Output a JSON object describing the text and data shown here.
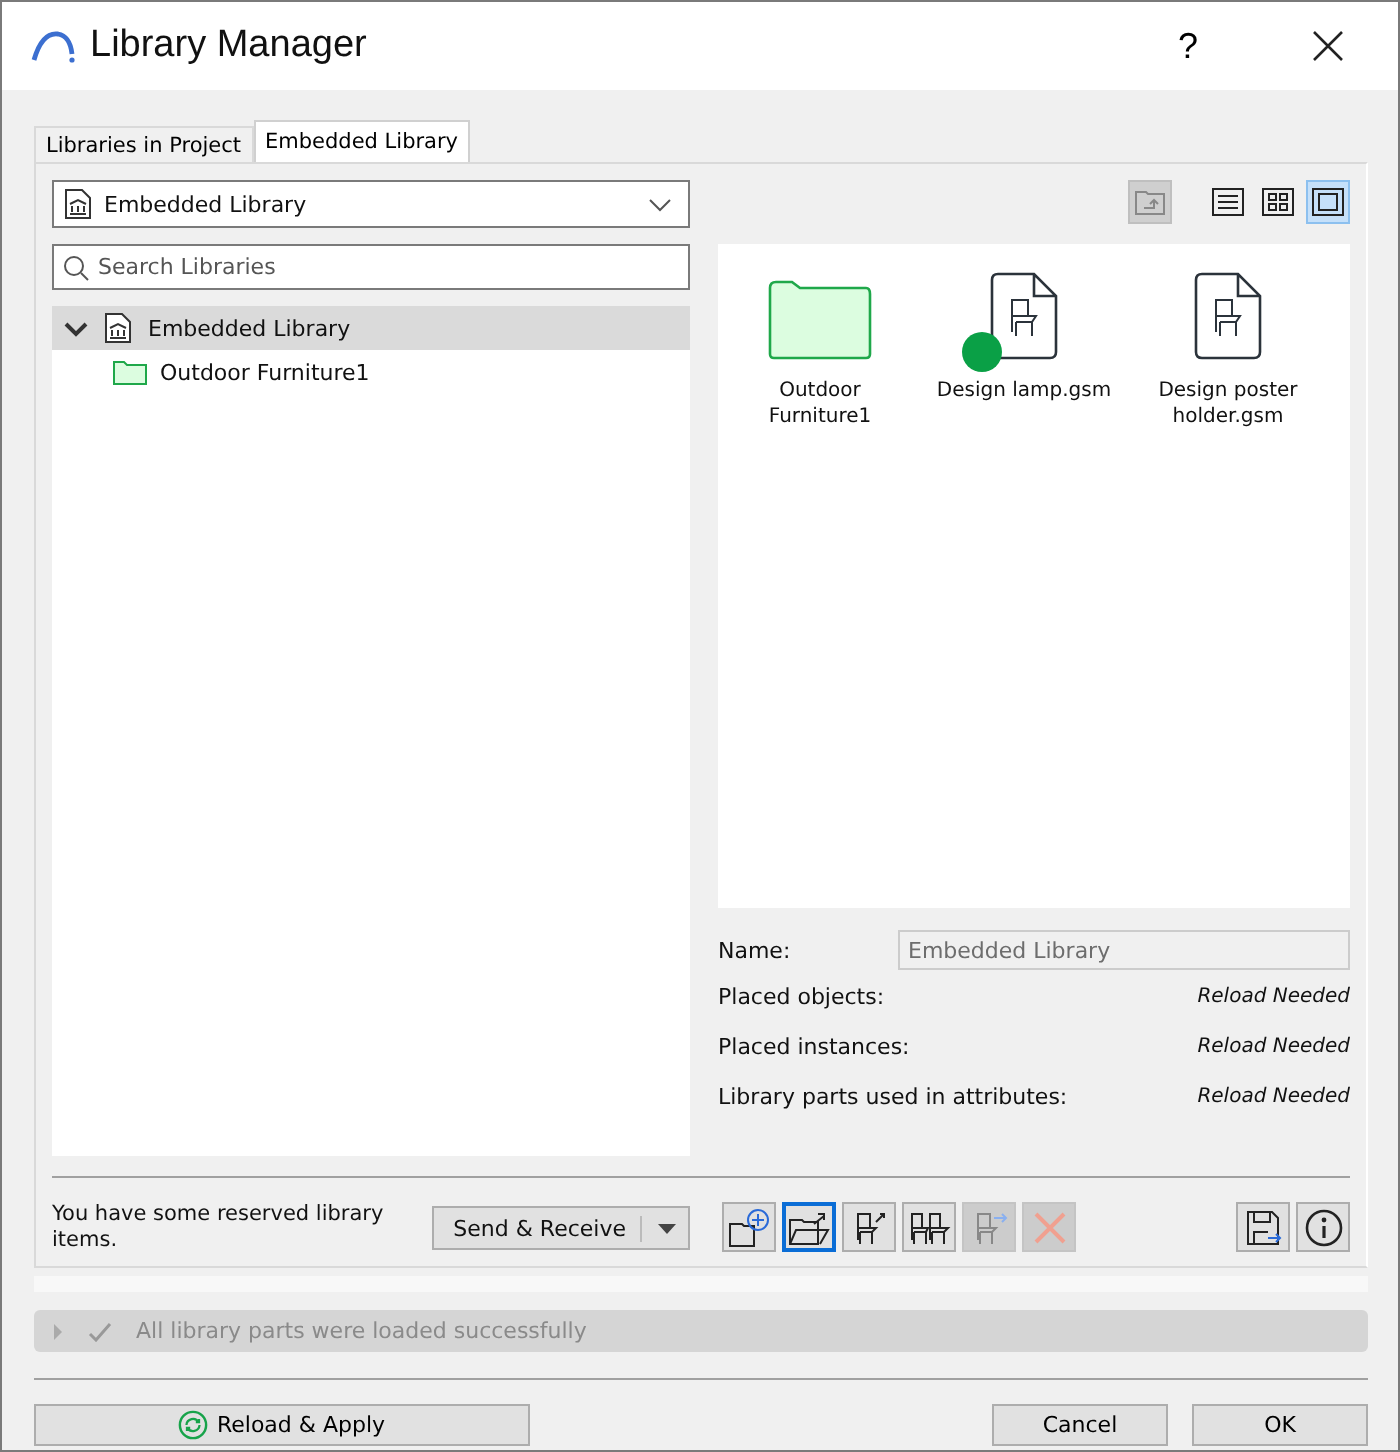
{
  "window": {
    "title": "Library Manager",
    "help": "?"
  },
  "tabs": [
    {
      "label": "Libraries in Project",
      "selected": false
    },
    {
      "label": "Embedded Library",
      "selected": true
    }
  ],
  "library_select": {
    "value": "Embedded Library"
  },
  "search": {
    "placeholder": "Search Libraries"
  },
  "tree": [
    {
      "label": "Embedded Library",
      "kind": "library",
      "expanded": true,
      "selected": true,
      "children": [
        {
          "label": "Outdoor Furniture1",
          "kind": "folder",
          "selected": false
        }
      ]
    }
  ],
  "view_buttons": [
    {
      "kind": "up",
      "selected": false,
      "disabled": true
    },
    {
      "kind": "list",
      "selected": false,
      "disabled": false
    },
    {
      "kind": "grid",
      "selected": false,
      "disabled": false
    },
    {
      "kind": "large",
      "selected": true,
      "disabled": false
    }
  ],
  "items": [
    {
      "label": "Outdoor Furniture1",
      "kind": "folder",
      "reserved": false
    },
    {
      "label": "Design lamp.gsm",
      "kind": "object",
      "reserved": true
    },
    {
      "label": "Design poster holder.gsm",
      "kind": "object",
      "reserved": false
    }
  ],
  "name_field": {
    "label": "Name:",
    "value": "Embedded Library"
  },
  "info_rows": [
    {
      "label": "Placed objects:",
      "value": "Reload Needed"
    },
    {
      "label": "Placed instances:",
      "value": "Reload Needed"
    },
    {
      "label": "Library parts used in attributes:",
      "value": "Reload Needed"
    }
  ],
  "reserved_message": "You have some reserved library items.",
  "send_receive": {
    "label": "Send & Receive"
  },
  "tools": [
    {
      "kind": "add-folder",
      "selected": false,
      "disabled": false
    },
    {
      "kind": "open-folder",
      "selected": true,
      "disabled": false
    },
    {
      "kind": "export-object",
      "selected": false,
      "disabled": false
    },
    {
      "kind": "objects",
      "selected": false,
      "disabled": false
    },
    {
      "kind": "move-object",
      "selected": false,
      "disabled": true
    },
    {
      "kind": "delete",
      "selected": false,
      "disabled": true
    }
  ],
  "side_tools": [
    {
      "kind": "save"
    },
    {
      "kind": "info"
    }
  ],
  "status": {
    "text": "All library parts were loaded successfully",
    "expanded": false
  },
  "buttons": {
    "reload": "Reload & Apply",
    "cancel": "Cancel",
    "ok": "OK"
  }
}
